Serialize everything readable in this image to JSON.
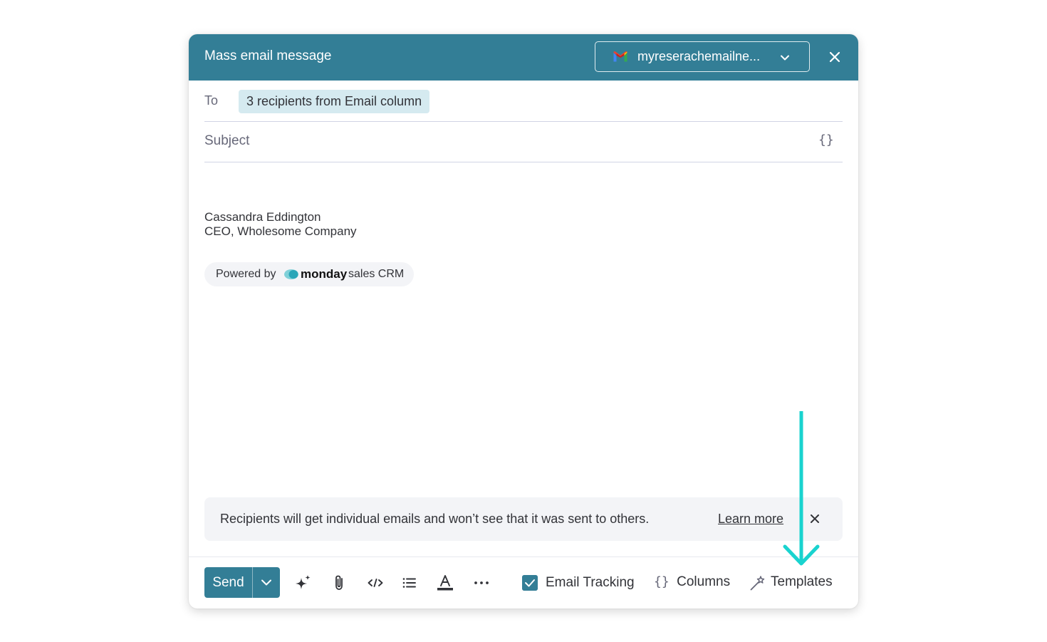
{
  "header": {
    "title": "Mass email message",
    "account_label": "myreserachemailne...",
    "background_color": "#337e96"
  },
  "compose": {
    "to_label": "To",
    "recipients_chip": "3 recipients from Email column",
    "subject_placeholder": "Subject",
    "subject_value": "",
    "variables_icon": "{}"
  },
  "signature": {
    "name": "Cassandra Eddington",
    "title": "CEO, Wholesome Company"
  },
  "powered_by": {
    "prefix": "Powered by",
    "brand": "monday",
    "suffix": "sales CRM"
  },
  "info_banner": {
    "text": "Recipients will get individual emails and won’t see that it was sent to others.",
    "link": "Learn more"
  },
  "toolbar": {
    "send_label": "Send",
    "tracking_label": "Email Tracking",
    "tracking_checked": true,
    "columns_icon": "{}",
    "columns_label": "Columns",
    "templates_label": "Templates",
    "icons": [
      "ai-sparkle-icon",
      "attachment-icon",
      "code-icon",
      "list-icon",
      "text-color-icon",
      "more-icon"
    ]
  },
  "annotation": {
    "arrow_color": "#19d3cf"
  }
}
